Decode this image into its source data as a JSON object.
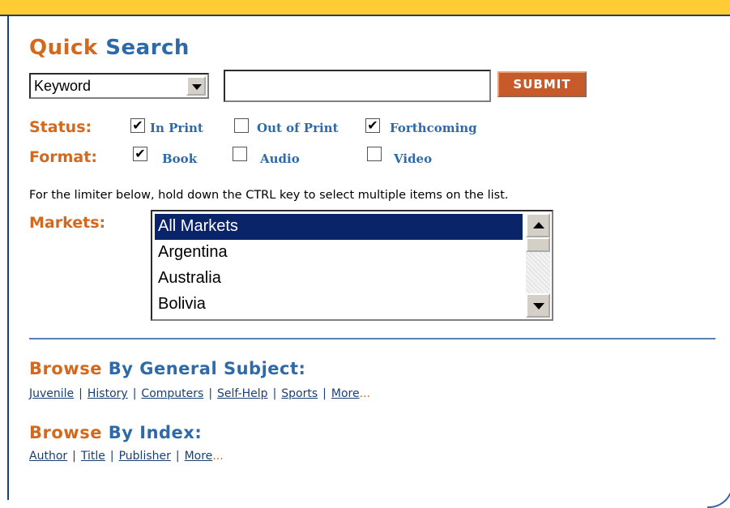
{
  "header": {
    "title_word1": "Quick",
    "title_word2": "Search"
  },
  "search": {
    "type_selected": "Keyword",
    "query_value": "",
    "submit_label": "SUBMIT"
  },
  "status": {
    "label": "Status:",
    "options": [
      {
        "label": "In Print",
        "checked": true
      },
      {
        "label": "Out of Print",
        "checked": false
      },
      {
        "label": "Forthcoming",
        "checked": true
      }
    ]
  },
  "format": {
    "label": "Format:",
    "options": [
      {
        "label": "Book",
        "checked": true
      },
      {
        "label": "Audio",
        "checked": false
      },
      {
        "label": "Video",
        "checked": false
      }
    ]
  },
  "instructions": "For the limiter below, hold down the CTRL key to select multiple items on the list.",
  "markets": {
    "label": "Markets:",
    "items": [
      "All Markets",
      "Argentina",
      "Australia",
      "Bolivia"
    ],
    "selected": "All Markets"
  },
  "browse_subject": {
    "title_word1": "Browse",
    "title_rest": "By General Subject:",
    "links": [
      "Juvenile",
      "History",
      "Computers",
      "Self-Help",
      "Sports",
      "More"
    ],
    "more_suffix": "..."
  },
  "browse_index": {
    "title_word1": "Browse",
    "title_rest": "By Index:",
    "links": [
      "Author",
      "Title",
      "Publisher",
      "More"
    ],
    "more_suffix": "..."
  },
  "check_glyph": "✔",
  "colors": {
    "accent_orange": "#D2691E",
    "accent_blue": "#2E6AA8",
    "bar_yellow": "#FFCC33",
    "select_navy": "#0A246A"
  }
}
